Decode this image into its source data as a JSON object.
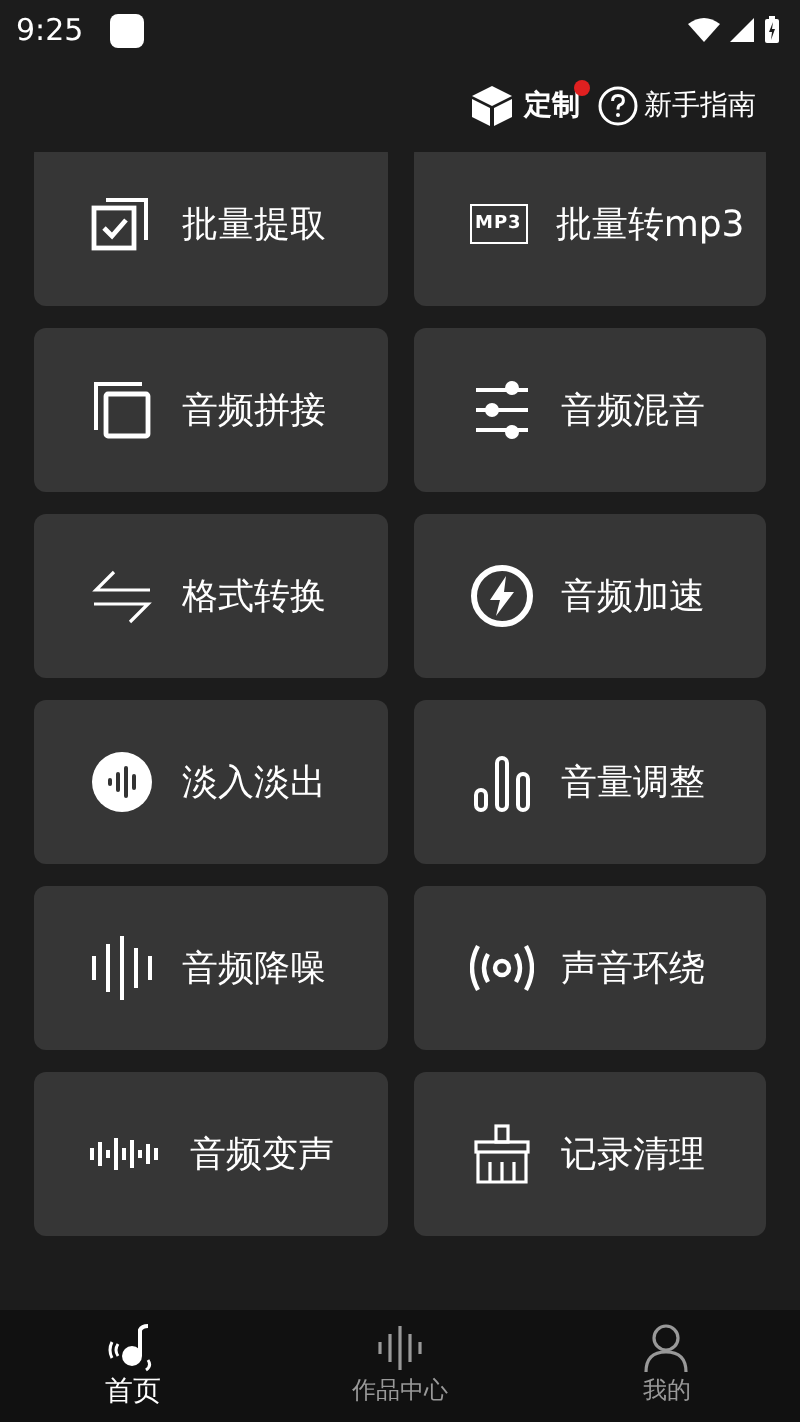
{
  "status_bar": {
    "time": "9:25"
  },
  "header": {
    "customize": {
      "label": "定制",
      "has_dot": true
    },
    "guide": {
      "label": "新手指南"
    }
  },
  "tools": [
    {
      "label": "批量提取"
    },
    {
      "label": "批量转mp3",
      "icon_text": "MP3"
    },
    {
      "label": "音频拼接"
    },
    {
      "label": "音频混音"
    },
    {
      "label": "格式转换"
    },
    {
      "label": "音频加速"
    },
    {
      "label": "淡入淡出"
    },
    {
      "label": "音量调整"
    },
    {
      "label": "音频降噪"
    },
    {
      "label": "声音环绕"
    },
    {
      "label": "音频变声"
    },
    {
      "label": "记录清理"
    }
  ],
  "bottom_nav": [
    {
      "label": "首页",
      "selected": true
    },
    {
      "label": "作品中心",
      "selected": false
    },
    {
      "label": "我的",
      "selected": false
    }
  ]
}
